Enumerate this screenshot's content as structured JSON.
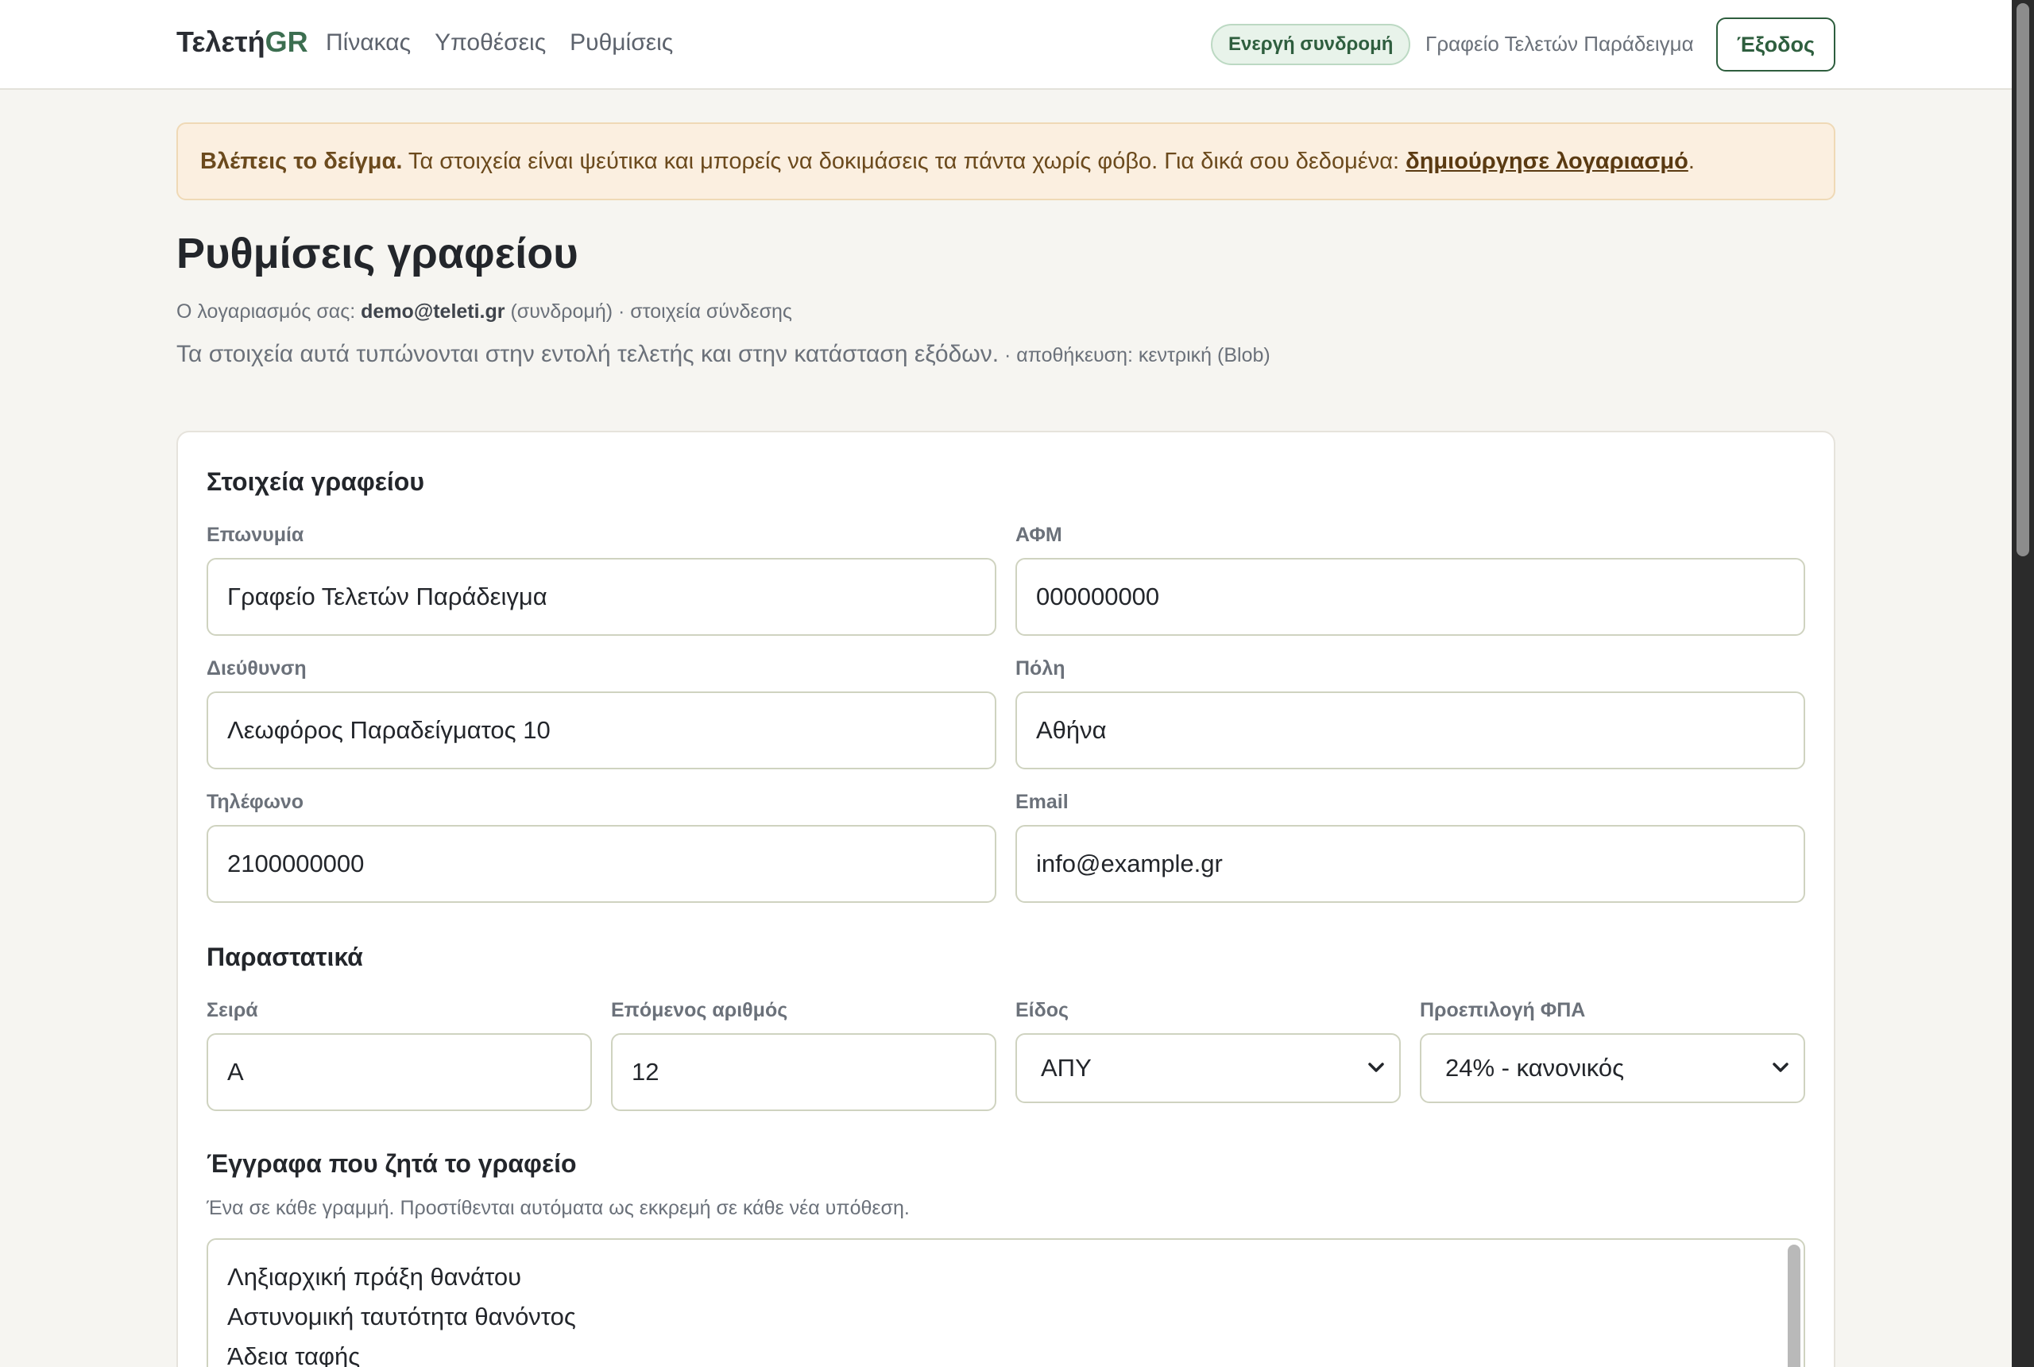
{
  "nav": {
    "brand_main": "Τελετή",
    "brand_suffix": "GR",
    "links": [
      "Πίνακας",
      "Υποθέσεις",
      "Ρυθμίσεις"
    ],
    "subscription_badge": "Ενεργή συνδρομή",
    "office_name": "Γραφείο Τελετών Παράδειγμα",
    "logout_label": "Έξοδος"
  },
  "banner": {
    "bold": "Βλέπεις το δείγμα.",
    "text": " Τα στοιχεία είναι ψεύτικα και μπορείς να δοκιμάσεις τα πάντα χωρίς φόβο. Για δικά σου δεδομένα: ",
    "link": "δημιούργησε λογαριασμό",
    "end": "."
  },
  "header": {
    "title": "Ρυθμίσεις γραφείου",
    "account_prefix": "Ο λογαριασμός σας: ",
    "account_email": "demo@teleti.gr",
    "account_suffix": " (συνδρομή) · στοιχεία σύνδεσης",
    "description": "Τα στοιχεία αυτά τυπώνονται στην εντολή τελετής και στην κατάσταση εξόδων.",
    "storage_note": " · αποθήκευση: κεντρική (Blob)"
  },
  "office": {
    "section_title": "Στοιχεία γραφείου",
    "name_label": "Επωνυμία",
    "name_value": "Γραφείο Τελετών Παράδειγμα",
    "vat_label": "ΑΦΜ",
    "vat_value": "000000000",
    "address_label": "Διεύθυνση",
    "address_value": "Λεωφόρος Παραδείγματος 10",
    "city_label": "Πόλη",
    "city_value": "Αθήνα",
    "phone_label": "Τηλέφωνο",
    "phone_value": "2100000000",
    "email_label": "Email",
    "email_value": "info@example.gr"
  },
  "documents": {
    "section_title": "Παραστατικά",
    "series_label": "Σειρά",
    "series_value": "Α",
    "next_number_label": "Επόμενος αριθμός",
    "next_number_value": "12",
    "type_label": "Είδος",
    "type_value": "ΑΠΥ",
    "vat_default_label": "Προεπιλογή ΦΠΑ",
    "vat_default_value": "24% - κανονικός"
  },
  "required_docs": {
    "section_title": "Έγγραφα που ζητά το γραφείο",
    "hint": "Ένα σε κάθε γραμμή. Προστίθενται αυτόματα ως εκκρεμή σε κάθε νέα υπόθεση.",
    "lines": [
      "Ληξιαρχική πράξη θανάτου",
      "Αστυνομική ταυτότητα θανόντος",
      "Άδεια ταφής"
    ]
  },
  "icons": {
    "select_arrow": "chevron-down-icon"
  },
  "colors": {
    "brand_green": "#3c6e50",
    "banner_bg": "#fbefe0",
    "page_bg": "#f6f5f1"
  }
}
